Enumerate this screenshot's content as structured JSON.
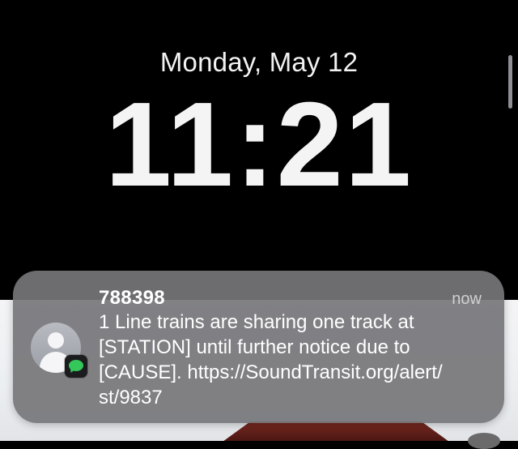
{
  "lock_screen": {
    "date": "Monday, May 12",
    "time": "11:21"
  },
  "notification": {
    "sender": "788398",
    "timestamp": "now",
    "app_icon": "messages-icon",
    "avatar_icon": "person-icon",
    "message": "1 Line trains are sharing one track at\n[STATION] until further notice due to\n[CAUSE]. https://SoundTransit.org/alert/\nst/9837"
  },
  "colors": {
    "notification_background": "#76767a",
    "messages_green": "#34c759",
    "background": "#000000"
  }
}
